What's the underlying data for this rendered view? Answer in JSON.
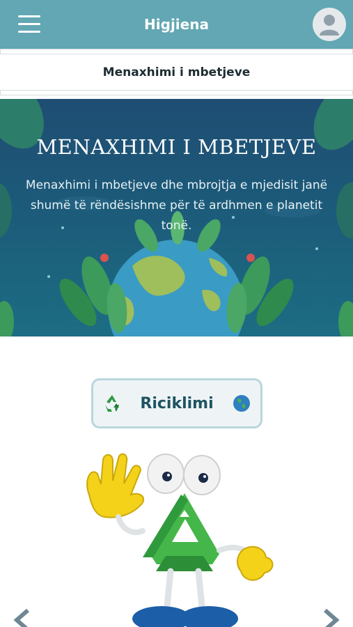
{
  "appbar": {
    "title": "Higjiena",
    "menu_icon": "hamburger-menu-icon",
    "avatar_icon": "user-avatar-icon"
  },
  "page": {
    "subtitle": "Menaxhimi i mbetjeve"
  },
  "hero": {
    "title": "MENAXHIMI I MBETJEVE",
    "description": "Menaxhimi i mbetjeve dhe mbrojtja e mjedisit janë shumë të rëndësishme për të ardhmen e planetit tonë."
  },
  "topic_button": {
    "label": "Riciklimi",
    "left_icon": "recycle-icon",
    "right_icon": "globe-icon"
  },
  "carousel": {
    "prev_icon": "chevron-left-icon",
    "next_icon": "chevron-right-icon"
  },
  "colors": {
    "appbar": "#62a7b3",
    "hero_dark": "#1f4d73",
    "chip_border": "#b9d6dc",
    "chip_text": "#1e5460"
  }
}
